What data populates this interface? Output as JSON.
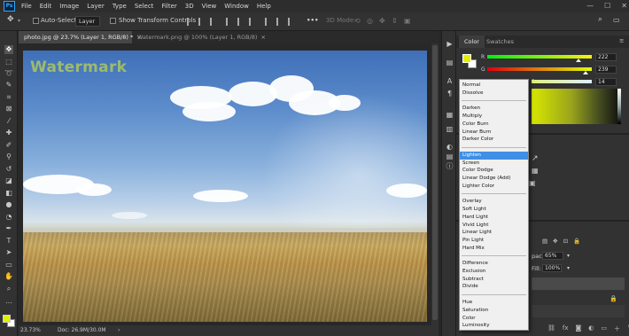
{
  "app": {
    "logo": "Ps"
  },
  "menubar": {
    "items": [
      "File",
      "Edit",
      "Image",
      "Layer",
      "Type",
      "Select",
      "Filter",
      "3D",
      "View",
      "Window",
      "Help"
    ],
    "window_controls": [
      "—",
      "☐",
      "✕"
    ]
  },
  "options": {
    "move_icon": "move-tool-icon",
    "auto_select_label": "Auto-Select:",
    "layer_value": "Layer",
    "transform_label": "Show Transform Controls",
    "more": "•••",
    "mode_3d": "3D Mode:"
  },
  "tabs": [
    {
      "label": "photo.jpg @ 23.7% (Layer 1, RGB/8) *",
      "close": "×"
    },
    {
      "label": "Watermark.png @ 100% (Layer 1, RGB/8)",
      "close": "×"
    }
  ],
  "canvas": {
    "watermark_text": "Watermark"
  },
  "status": {
    "zoom": "23.73%",
    "doc": "Doc: 26.9M/30.0M",
    "arrow": "›"
  },
  "color_panel": {
    "tabs": [
      "Color",
      "Swatches"
    ],
    "fg_color": "#e2f000",
    "bg_color": "#ffffff",
    "channels": [
      {
        "label": "R",
        "value": "222"
      },
      {
        "label": "G",
        "value": "239"
      },
      {
        "label": "B",
        "value": "14"
      }
    ]
  },
  "layers_panel": {
    "opacity_label": "pacity:",
    "opacity_value": "65%",
    "fill_label": "Fill:",
    "fill_value": "100%"
  },
  "blend_modes": [
    [
      "Normal",
      "Dissolve"
    ],
    [
      "Darken",
      "Multiply",
      "Color Burn",
      "Linear Burn",
      "Darker Color"
    ],
    [
      "Lighten",
      "Screen",
      "Color Dodge",
      "Linear Dodge (Add)",
      "Lighter Color"
    ],
    [
      "Overlay",
      "Soft Light",
      "Hard Light",
      "Vivid Light",
      "Linear Light",
      "Pin Light",
      "Hard Mix"
    ],
    [
      "Difference",
      "Exclusion",
      "Subtract",
      "Divide"
    ],
    [
      "Hue",
      "Saturation",
      "Color",
      "Luminosity"
    ]
  ],
  "blend_selected": "Lighten"
}
